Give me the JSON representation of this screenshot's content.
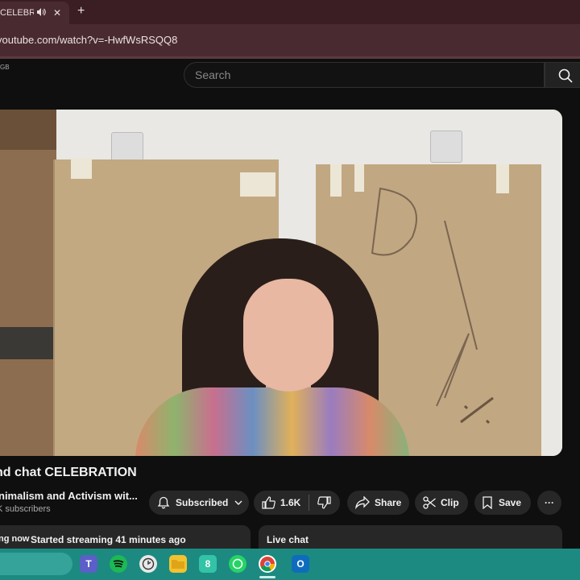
{
  "browser": {
    "tab_title": "CELEBRATIO",
    "tab_audio_icon": "speaker-icon",
    "tab_close": "✕",
    "new_tab": "+",
    "url": "youtube.com/watch?v=-HwfWsRSQQ8"
  },
  "header": {
    "region": "GB",
    "search_placeholder": "Search"
  },
  "video": {
    "title": "nd chat CELEBRATION",
    "channel_name": "nimalism and Activism wit...",
    "subscribers": "K subscribers"
  },
  "actions": {
    "subscribed": "Subscribed",
    "likes": "1.6K",
    "share": "Share",
    "clip": "Clip",
    "save": "Save",
    "more": "···"
  },
  "info": {
    "status": "ng now",
    "started": "Started streaming 41 minutes ago"
  },
  "chat": {
    "label": "Live chat"
  },
  "colors": {
    "background": "#0f0f0f",
    "tab_strip": "#3a1e24",
    "taskbar": "#1c8a80"
  }
}
